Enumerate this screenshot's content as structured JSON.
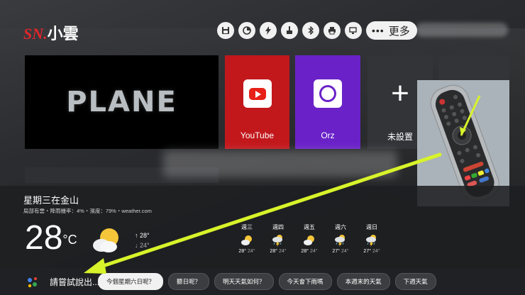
{
  "header": {
    "brand": "SN.",
    "app_name": "小雲",
    "quick_icons": [
      "save-icon",
      "disc-icon",
      "bolt-icon",
      "clean-brush-icon",
      "bluetooth-icon",
      "printer-icon",
      "screen-icon"
    ],
    "more_label": "更多",
    "more_dots": "•••"
  },
  "tiles": {
    "featured_title": "PLANE",
    "apps": [
      {
        "label": "YouTube"
      },
      {
        "label": "Orz"
      },
      {
        "label": "未設置"
      }
    ]
  },
  "weather": {
    "title": "星期三在金山",
    "subtitle": "局部有雲・降雨機率：4%・濕度：79%・weather.com",
    "temp": "28",
    "unit": "°C",
    "high": "↑ 28°",
    "low": "↓ 24°",
    "forecast": [
      {
        "day": "週三",
        "hi": "28°",
        "lo": "24°",
        "icon": "partly-cloudy-icon"
      },
      {
        "day": "週四",
        "hi": "28°",
        "lo": "24°",
        "icon": "thunderstorm-icon"
      },
      {
        "day": "週五",
        "hi": "28°",
        "lo": "24°",
        "icon": "partly-cloudy-icon"
      },
      {
        "day": "週六",
        "hi": "27°",
        "lo": "24°",
        "icon": "thunderstorm-icon"
      },
      {
        "day": "週日",
        "hi": "27°",
        "lo": "24°",
        "icon": "thunderstorm-icon"
      }
    ]
  },
  "assistant": {
    "prompt": "請嘗試說出...",
    "chips": [
      "今個星期六日呢？",
      "聽日呢？",
      "明天天氣如何？",
      "今天會下雨嗎",
      "本週末的天氣",
      "下週天氣"
    ]
  },
  "colors": {
    "brand_red": "#e0262b",
    "youtube_tile": "#c2181c",
    "orz_tile": "#6a22c8",
    "arrow": "#d8f32a"
  }
}
